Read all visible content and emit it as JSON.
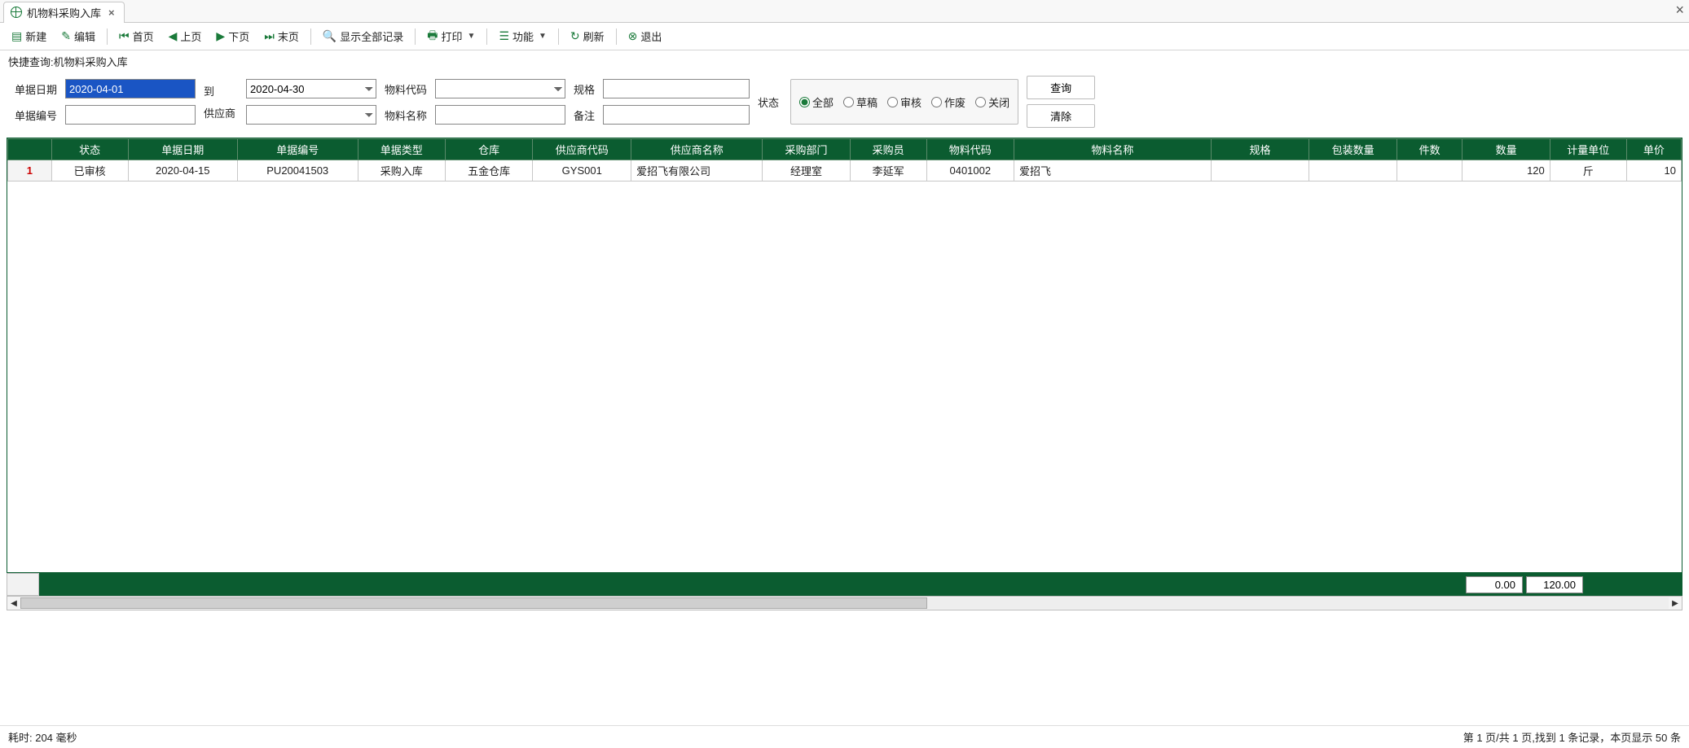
{
  "tab": {
    "title": "机物料采购入库"
  },
  "toolbar": {
    "new": "新建",
    "edit": "编辑",
    "first": "首页",
    "prev": "上页",
    "next": "下页",
    "last": "末页",
    "showall": "显示全部记录",
    "print": "打印",
    "func": "功能",
    "refresh": "刷新",
    "exit": "退出"
  },
  "quick_query_label": "快捷查询:机物料采购入库",
  "filters": {
    "doc_date_label": "单据日期",
    "date_from": "2020-04-01",
    "to_label": "到",
    "date_to": "2020-04-30",
    "mat_code_label": "物料代码",
    "mat_code": "",
    "spec_label": "规格",
    "spec": "",
    "doc_no_label": "单据编号",
    "doc_no": "",
    "supplier_label": "供应商",
    "supplier": "",
    "mat_name_label": "物料名称",
    "mat_name": "",
    "remark_label": "备注",
    "remark": "",
    "status_label": "状态",
    "radios": {
      "all": "全部",
      "draft": "草稿",
      "review": "审核",
      "void": "作废",
      "closed": "关闭"
    },
    "query_btn": "查询",
    "clear_btn": "清除"
  },
  "columns": [
    "",
    "状态",
    "单据日期",
    "单据编号",
    "单据类型",
    "仓库",
    "供应商代码",
    "供应商名称",
    "采购部门",
    "采购员",
    "物料代码",
    "物料名称",
    "规格",
    "包装数量",
    "件数",
    "数量",
    "计量单位",
    "单价"
  ],
  "row": {
    "num": "1",
    "status": "已审核",
    "date": "2020-04-15",
    "docno": "PU20041503",
    "type": "采购入库",
    "wh": "五金仓库",
    "supcode": "GYS001",
    "supname": "爱招飞有限公司",
    "dept": "经理室",
    "buyer": "李延军",
    "matcode": "0401002",
    "matname": "爱招飞",
    "spec": "",
    "pkgqty": "",
    "pcs": "",
    "qty": "120",
    "uom": "斤",
    "price": "10"
  },
  "summary": {
    "v1": "0.00",
    "v2": "120.00"
  },
  "status_left": "耗时: 204 毫秒",
  "status_right": "第 1 页/共 1 页,找到 1 条记录，本页显示 50 条"
}
